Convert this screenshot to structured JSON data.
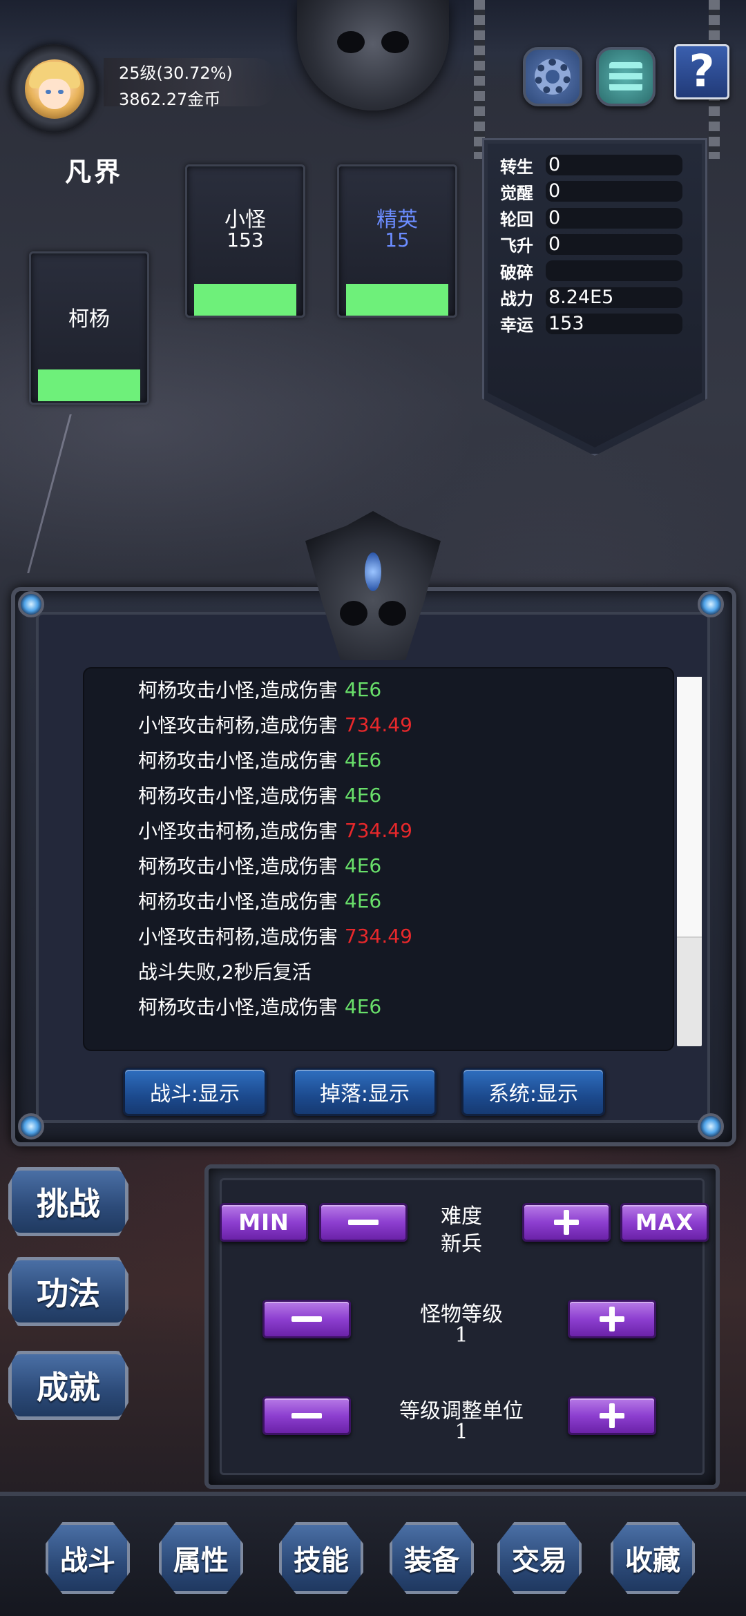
{
  "header": {
    "level_text": "25级(30.72%)",
    "gold_text": "3862.27金币",
    "realm": "凡界",
    "help_label": "?"
  },
  "icons": {
    "settings": "gear-icon",
    "menu": "hamburger-menu-icon",
    "help": "question-mark-icon"
  },
  "cards": {
    "player": {
      "name": "柯杨",
      "hp_fraction": 1.0
    },
    "minion": {
      "name": "小怪",
      "count": "153",
      "hp_fraction": 1.0
    },
    "elite": {
      "name": "精英",
      "count": "15",
      "hp_fraction": 1.0
    }
  },
  "colors": {
    "hp_bar": "#6ef07a",
    "elite_text": "#6b8cff",
    "player_damage": "#69e06a",
    "enemy_damage": "#e8282b",
    "filter_button": "#2f6fc0",
    "purple_button": "#8d3fd0"
  },
  "stats": [
    {
      "label": "转生",
      "value": "0"
    },
    {
      "label": "觉醒",
      "value": "0"
    },
    {
      "label": "轮回",
      "value": "0"
    },
    {
      "label": "飞升",
      "value": "0"
    },
    {
      "label": "破碎",
      "value": ""
    },
    {
      "label": "战力",
      "value": "8.24E5"
    },
    {
      "label": "幸运",
      "value": "153"
    }
  ],
  "log": [
    {
      "text": "柯杨攻击小怪,造成伤害",
      "damage": "4E6",
      "type": "player"
    },
    {
      "text": "小怪攻击柯杨,造成伤害",
      "damage": "734.49",
      "type": "enemy"
    },
    {
      "text": "柯杨攻击小怪,造成伤害",
      "damage": "4E6",
      "type": "player"
    },
    {
      "text": "柯杨攻击小怪,造成伤害",
      "damage": "4E6",
      "type": "player"
    },
    {
      "text": "小怪攻击柯杨,造成伤害",
      "damage": "734.49",
      "type": "enemy"
    },
    {
      "text": "柯杨攻击小怪,造成伤害",
      "damage": "4E6",
      "type": "player"
    },
    {
      "text": "柯杨攻击小怪,造成伤害",
      "damage": "4E6",
      "type": "player"
    },
    {
      "text": "小怪攻击柯杨,造成伤害",
      "damage": "734.49",
      "type": "enemy"
    },
    {
      "text": "战斗失败,2秒后复活",
      "damage": "",
      "type": "system"
    },
    {
      "text": "柯杨攻击小怪,造成伤害",
      "damage": "4E6",
      "type": "player"
    }
  ],
  "filters": {
    "battle": "战斗:显示",
    "drop": "掉落:显示",
    "system": "系统:显示"
  },
  "side_buttons": {
    "challenge": "挑战",
    "technique": "功法",
    "achievement": "成就"
  },
  "controls": {
    "min_label": "MIN",
    "max_label": "MAX",
    "difficulty_title": "难度",
    "difficulty_value": "新兵",
    "monster_level_title": "怪物等级",
    "monster_level_value": "1",
    "level_step_title": "等级调整单位",
    "level_step_value": "1"
  },
  "nav": [
    {
      "key": "battle",
      "label": "战斗"
    },
    {
      "key": "attributes",
      "label": "属性"
    },
    {
      "key": "skills",
      "label": "技能"
    },
    {
      "key": "equipment",
      "label": "装备"
    },
    {
      "key": "trade",
      "label": "交易"
    },
    {
      "key": "collection",
      "label": "收藏"
    }
  ]
}
